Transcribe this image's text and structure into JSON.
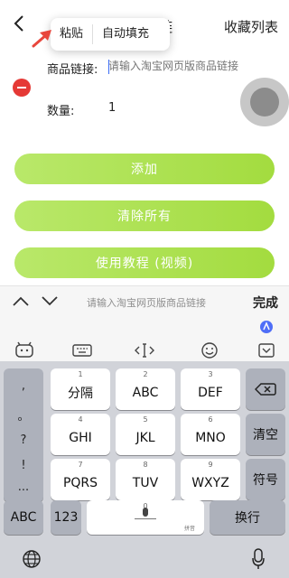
{
  "header": {
    "title_partial": "链",
    "favorites_label": "收藏列表"
  },
  "popup": {
    "paste_label": "粘贴",
    "autofill_label": "自动填充"
  },
  "form": {
    "link_label": "商品链接:",
    "link_placeholder": "请输入淘宝网页版商品链接",
    "quantity_label": "数量:",
    "quantity_value": "1"
  },
  "buttons": {
    "add_label": "添加",
    "clear_label": "清除所有",
    "tutorial_label": "使用教程 (视频)"
  },
  "keyboard": {
    "top_placeholder": "请输入淘宝网页版商品链接",
    "done_label": "完成",
    "punctuation": [
      ",",
      "。",
      "?",
      "!",
      "..."
    ],
    "rows": [
      [
        {
          "num": "1",
          "label": "分隔"
        },
        {
          "num": "2",
          "label": "ABC"
        },
        {
          "num": "3",
          "label": "DEF"
        }
      ],
      [
        {
          "num": "4",
          "label": "GHI"
        },
        {
          "num": "5",
          "label": "JKL"
        },
        {
          "num": "6",
          "label": "MNO"
        }
      ],
      [
        {
          "num": "7",
          "label": "PQRS"
        },
        {
          "num": "8",
          "label": "TUV"
        },
        {
          "num": "9",
          "label": "WXYZ"
        }
      ]
    ],
    "clear_label": "清空",
    "symbol_label": "符号",
    "abc_label": "ABC",
    "num_label": "123",
    "space_num": "0",
    "pinyin_tag": "拼音",
    "newline_label": "换行"
  },
  "colors": {
    "accent_green": "#a3dc3f",
    "remove_red": "#e53935",
    "popup_arrow_red": "#e8463c",
    "caret_blue": "#3b6cf5"
  }
}
